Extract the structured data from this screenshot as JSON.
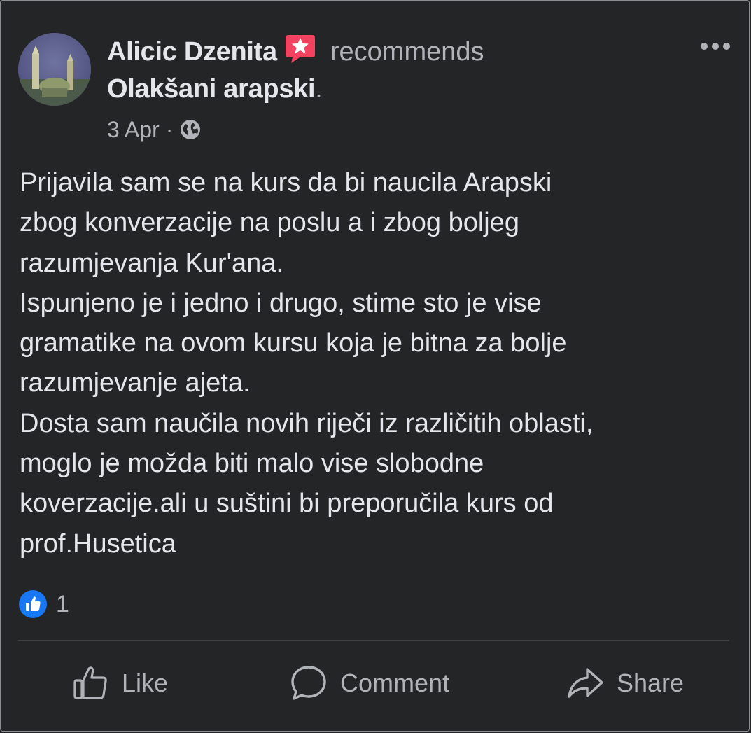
{
  "post": {
    "author": "Alicic Dzenita",
    "action_text": "recommends",
    "page_name": "Olakšani arapski",
    "page_suffix": ".",
    "date": "3 Apr",
    "separator": "·",
    "privacy_icon": "globe-icon",
    "recommend_icon": "recommend-star-icon",
    "more_icon": "more-options-icon",
    "body_lines": [
      "Prijavila sam se na kurs da bi naucila Arapski",
      "zbog konverzacije na poslu a i zbog boljeg",
      "razumjevanja Kur'ana.",
      "Ispunjeno je i jedno i drugo, stime sto je vise",
      "gramatike na ovom kursu koja je bitna za bolje",
      "razumjevanje ajeta.",
      "Dosta sam naučila novih riječi iz različitih oblasti,",
      "moglo je možda biti malo vise slobodne",
      "koverzacije.ali u suštini bi preporučila kurs od",
      "prof.Husetica"
    ]
  },
  "reactions": {
    "icon": "like-reaction-icon",
    "count": "1"
  },
  "actions": {
    "like": {
      "label": "Like",
      "icon": "thumbs-up-icon"
    },
    "comment": {
      "label": "Comment",
      "icon": "comment-bubble-icon"
    },
    "share": {
      "label": "Share",
      "icon": "share-arrow-icon"
    }
  },
  "colors": {
    "background": "#242526",
    "primary_text": "#e4e6eb",
    "secondary_text": "#b0b3b8",
    "like_blue": "#1877f2",
    "recommend_red": "#f3425f",
    "divider": "#3e4042"
  }
}
